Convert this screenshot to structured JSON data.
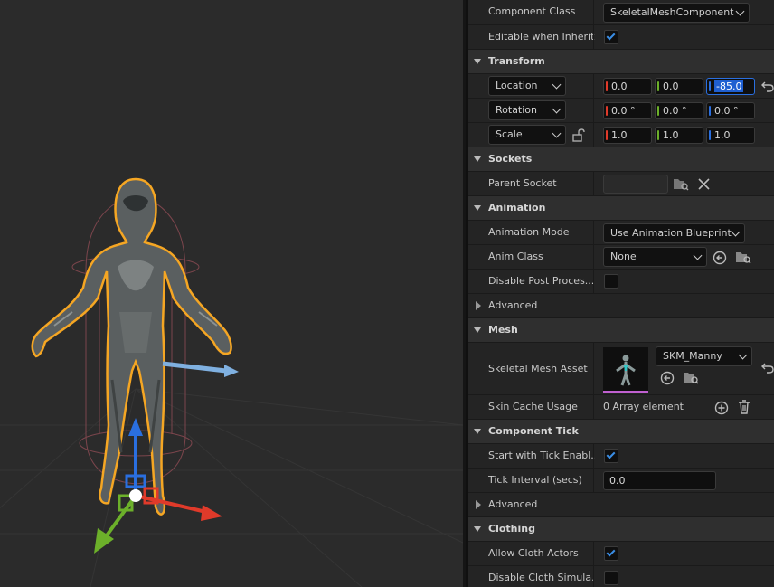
{
  "details": {
    "component_class": {
      "label": "Component Class",
      "value": "SkeletalMeshComponent"
    },
    "editable_inherited": {
      "label": "Editable when Inherit...",
      "checked": true
    },
    "transform": {
      "title": "Transform",
      "location": {
        "mode": "Location",
        "x": "0.0",
        "y": "0.0",
        "z": "-85.0"
      },
      "rotation": {
        "mode": "Rotation",
        "x": "0.0 °",
        "y": "0.0 °",
        "z": "0.0 °"
      },
      "scale": {
        "mode": "Scale",
        "x": "1.0",
        "y": "1.0",
        "z": "1.0"
      }
    },
    "sockets": {
      "title": "Sockets",
      "parent_socket_label": "Parent Socket",
      "parent_socket_value": ""
    },
    "animation": {
      "title": "Animation",
      "mode_label": "Animation Mode",
      "mode_value": "Use Animation Blueprint",
      "anim_class_label": "Anim Class",
      "anim_class_value": "None",
      "disable_post_label": "Disable Post Proces...",
      "disable_post_checked": false,
      "advanced": "Advanced"
    },
    "mesh": {
      "title": "Mesh",
      "asset_label": "Skeletal Mesh Asset",
      "asset_value": "SKM_Manny",
      "skin_cache_label": "Skin Cache Usage",
      "skin_cache_value": "0 Array element"
    },
    "component_tick": {
      "title": "Component Tick",
      "start_label": "Start with Tick Enabl...",
      "start_checked": true,
      "interval_label": "Tick Interval (secs)",
      "interval_value": "0.0",
      "advanced": "Advanced"
    },
    "clothing": {
      "title": "Clothing",
      "allow_label": "Allow Cloth Actors",
      "allow_checked": true,
      "disable_sim_label": "Disable Cloth Simula...",
      "disable_sim_checked": false
    }
  },
  "colors": {
    "axis_x": "#e03a2a",
    "axis_y": "#6cb02a",
    "axis_z": "#2a6fe0",
    "selection_outline": "#f5a623",
    "checkbox_accent": "#3a8ee6"
  }
}
